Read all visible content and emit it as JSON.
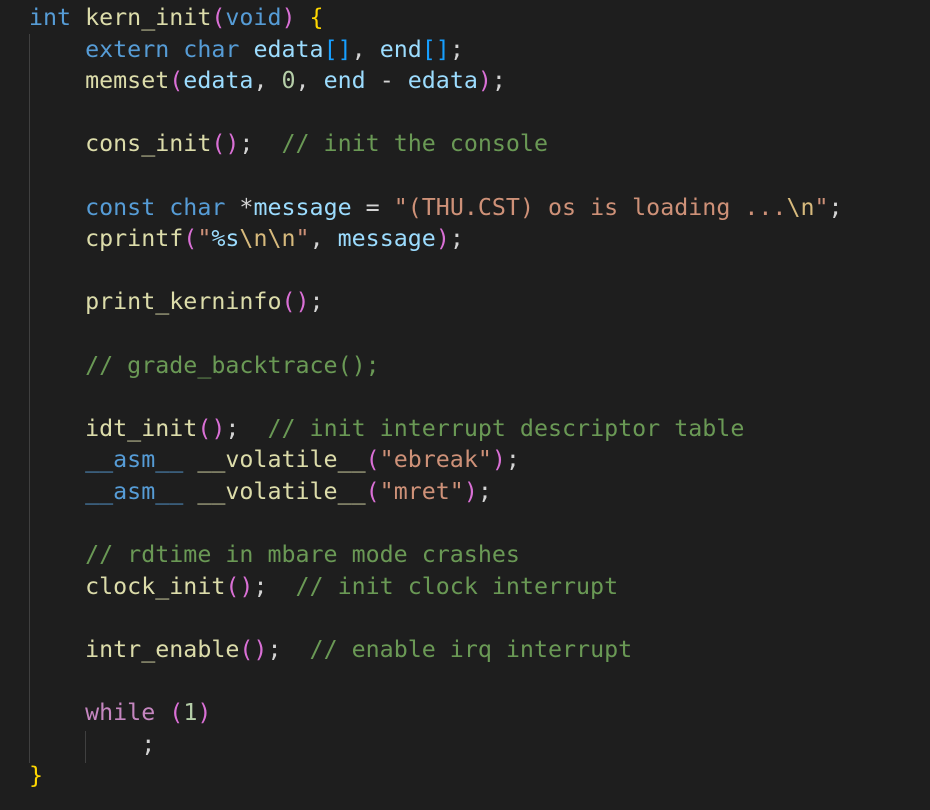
{
  "editor": {
    "language": "c",
    "theme_colors": {
      "background": "#1e1e1e",
      "keyword": "#569cd6",
      "control": "#c586c0",
      "function": "#dcdcaa",
      "variable": "#9cdcfe",
      "number": "#b5cea8",
      "string": "#ce9178",
      "escape": "#d7ba7d",
      "comment": "#6a9955",
      "bracket_level_1": "#ffd700",
      "bracket_level_2": "#da70d6",
      "bracket_level_3": "#179fff"
    },
    "lines": [
      [
        [
          "kw",
          "int"
        ],
        [
          "op",
          " "
        ],
        [
          "fn",
          "kern_init"
        ],
        [
          "b2",
          "("
        ],
        [
          "kw",
          "void"
        ],
        [
          "b2",
          ")"
        ],
        [
          "op",
          " "
        ],
        [
          "b1",
          "{"
        ]
      ],
      [
        [
          "op",
          "    "
        ],
        [
          "kw",
          "extern"
        ],
        [
          "op",
          " "
        ],
        [
          "kw",
          "char"
        ],
        [
          "op",
          " "
        ],
        [
          "var",
          "edata"
        ],
        [
          "b3",
          "[]"
        ],
        [
          "op",
          ", "
        ],
        [
          "var",
          "end"
        ],
        [
          "b3",
          "[]"
        ],
        [
          "op",
          ";"
        ]
      ],
      [
        [
          "op",
          "    "
        ],
        [
          "fn",
          "memset"
        ],
        [
          "b2",
          "("
        ],
        [
          "var",
          "edata"
        ],
        [
          "op",
          ", "
        ],
        [
          "num",
          "0"
        ],
        [
          "op",
          ", "
        ],
        [
          "var",
          "end"
        ],
        [
          "op",
          " - "
        ],
        [
          "var",
          "edata"
        ],
        [
          "b2",
          ")"
        ],
        [
          "op",
          ";"
        ]
      ],
      [],
      [
        [
          "op",
          "    "
        ],
        [
          "fn",
          "cons_init"
        ],
        [
          "b2",
          "()"
        ],
        [
          "op",
          ";  "
        ],
        [
          "cmt",
          "// init the console"
        ]
      ],
      [],
      [
        [
          "op",
          "    "
        ],
        [
          "kw",
          "const"
        ],
        [
          "op",
          " "
        ],
        [
          "kw",
          "char"
        ],
        [
          "op",
          " *"
        ],
        [
          "var",
          "message"
        ],
        [
          "op",
          " = "
        ],
        [
          "str",
          "\"(THU.CST) os is loading ..."
        ],
        [
          "esc",
          "\\n"
        ],
        [
          "str",
          "\""
        ],
        [
          "op",
          ";"
        ]
      ],
      [
        [
          "op",
          "    "
        ],
        [
          "fn",
          "cprintf"
        ],
        [
          "b2",
          "("
        ],
        [
          "str",
          "\""
        ],
        [
          "var",
          "%s"
        ],
        [
          "esc",
          "\\n\\n"
        ],
        [
          "str",
          "\""
        ],
        [
          "op",
          ", "
        ],
        [
          "var",
          "message"
        ],
        [
          "b2",
          ")"
        ],
        [
          "op",
          ";"
        ]
      ],
      [],
      [
        [
          "op",
          "    "
        ],
        [
          "fn",
          "print_kerninfo"
        ],
        [
          "b2",
          "()"
        ],
        [
          "op",
          ";"
        ]
      ],
      [],
      [
        [
          "op",
          "    "
        ],
        [
          "cmt",
          "// grade_backtrace();"
        ]
      ],
      [],
      [
        [
          "op",
          "    "
        ],
        [
          "fn",
          "idt_init"
        ],
        [
          "b2",
          "()"
        ],
        [
          "op",
          ";  "
        ],
        [
          "cmt",
          "// init interrupt descriptor table"
        ]
      ],
      [
        [
          "op",
          "    "
        ],
        [
          "kw",
          "__asm__"
        ],
        [
          "op",
          " "
        ],
        [
          "fn",
          "__volatile__"
        ],
        [
          "b2",
          "("
        ],
        [
          "str",
          "\"ebreak\""
        ],
        [
          "b2",
          ")"
        ],
        [
          "op",
          ";"
        ]
      ],
      [
        [
          "op",
          "    "
        ],
        [
          "kw",
          "__asm__"
        ],
        [
          "op",
          " "
        ],
        [
          "fn",
          "__volatile__"
        ],
        [
          "b2",
          "("
        ],
        [
          "str",
          "\"mret\""
        ],
        [
          "b2",
          ")"
        ],
        [
          "op",
          ";"
        ]
      ],
      [],
      [
        [
          "op",
          "    "
        ],
        [
          "cmt",
          "// rdtime in mbare mode crashes"
        ]
      ],
      [
        [
          "op",
          "    "
        ],
        [
          "fn",
          "clock_init"
        ],
        [
          "b2",
          "()"
        ],
        [
          "op",
          ";  "
        ],
        [
          "cmt",
          "// init clock interrupt"
        ]
      ],
      [],
      [
        [
          "op",
          "    "
        ],
        [
          "fn",
          "intr_enable"
        ],
        [
          "b2",
          "()"
        ],
        [
          "op",
          ";  "
        ],
        [
          "cmt",
          "// enable irq interrupt"
        ]
      ],
      [],
      [
        [
          "op",
          "    "
        ],
        [
          "ctl",
          "while"
        ],
        [
          "op",
          " "
        ],
        [
          "b2",
          "("
        ],
        [
          "num",
          "1"
        ],
        [
          "b2",
          ")"
        ]
      ],
      [
        [
          "op",
          "        "
        ],
        [
          "op",
          ";"
        ]
      ],
      [
        [
          "b1",
          "}"
        ]
      ]
    ]
  }
}
